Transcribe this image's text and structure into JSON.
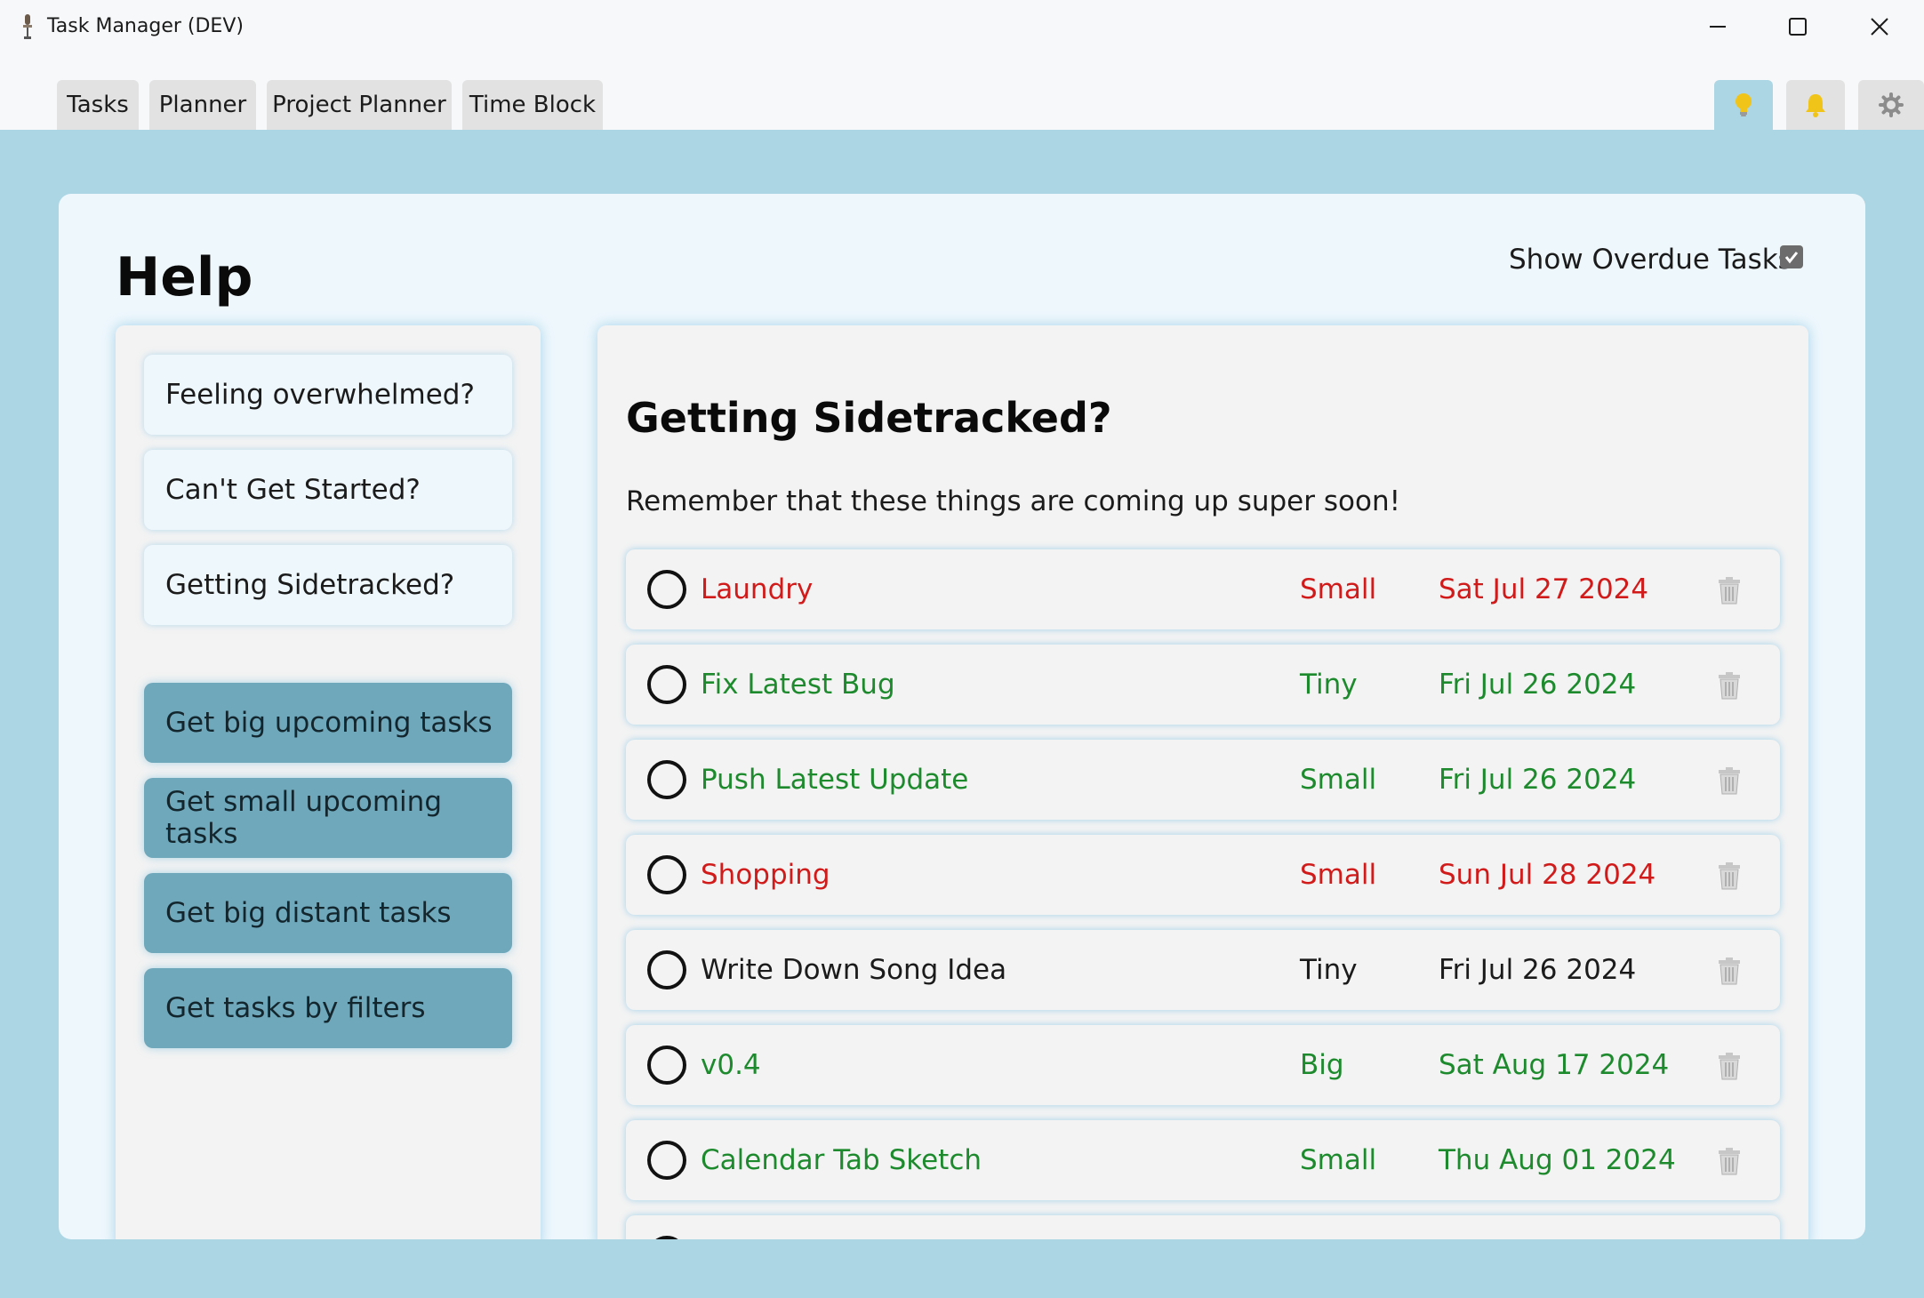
{
  "window": {
    "title": "Task Manager (DEV)",
    "controls": [
      "minimize-icon",
      "maximize-icon",
      "close-icon"
    ]
  },
  "tabs": [
    {
      "label": "Tasks"
    },
    {
      "label": "Planner"
    },
    {
      "label": "Project Planner"
    },
    {
      "label": "Time Block"
    }
  ],
  "icon_tabs": [
    {
      "icon": "lightbulb-icon",
      "active": true
    },
    {
      "icon": "bell-icon",
      "active": false
    },
    {
      "icon": "gear-icon",
      "active": false
    }
  ],
  "page": {
    "title": "Help",
    "overdue_label": "Show Overdue Tasks",
    "overdue_checked": true
  },
  "sidebar": {
    "help_topics": [
      {
        "label": "Feeling overwhelmed?"
      },
      {
        "label": "Can't Get Started?"
      },
      {
        "label": "Getting Sidetracked?"
      }
    ],
    "actions": [
      {
        "label": "Get big upcoming tasks"
      },
      {
        "label": "Get small upcoming tasks"
      },
      {
        "label": "Get big distant tasks"
      },
      {
        "label": "Get tasks by filters"
      }
    ]
  },
  "panel": {
    "title": "Getting Sidetracked?",
    "subtitle": "Remember that these things are coming up super soon!",
    "tasks": [
      {
        "name": "Laundry",
        "size": "Small",
        "date": "Sat Jul 27 2024",
        "status": "red"
      },
      {
        "name": "Fix Latest Bug",
        "size": "Tiny",
        "date": "Fri Jul 26 2024",
        "status": "green"
      },
      {
        "name": "Push Latest Update",
        "size": "Small",
        "date": "Fri Jul 26 2024",
        "status": "green"
      },
      {
        "name": "Shopping",
        "size": "Small",
        "date": "Sun Jul 28 2024",
        "status": "red"
      },
      {
        "name": "Write Down Song Idea",
        "size": "Tiny",
        "date": "Fri Jul 26 2024",
        "status": "black"
      },
      {
        "name": "v0.4",
        "size": "Big",
        "date": "Sat Aug 17 2024",
        "status": "green"
      },
      {
        "name": "Calendar Tab Sketch",
        "size": "Small",
        "date": "Thu Aug 01 2024",
        "status": "green"
      },
      {
        "name": "",
        "size": "",
        "date": "",
        "status": "black"
      }
    ]
  },
  "colors": {
    "accent_blue": "#acd6e4",
    "action_button": "#6fa7bb",
    "overdue_red": "#d11b1b",
    "upcoming_green": "#1e8a2e",
    "bulb_yellow": "#f0c419"
  }
}
